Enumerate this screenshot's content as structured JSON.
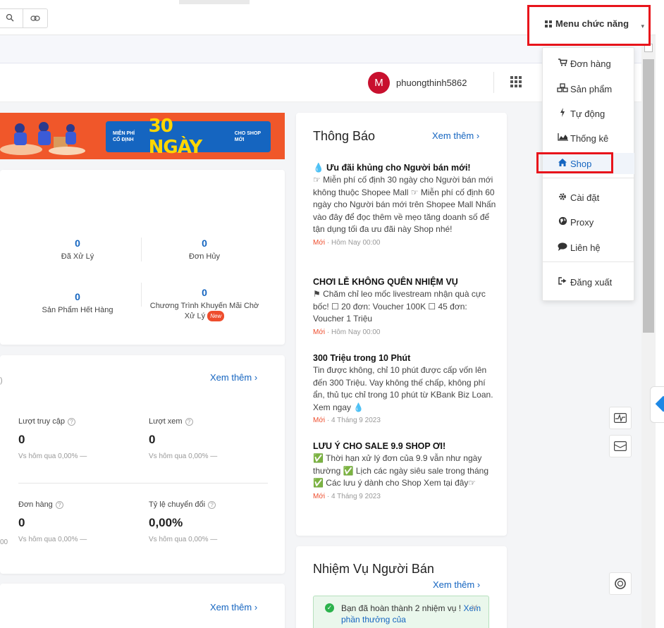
{
  "toolbar": {
    "zoom_icon": "zoom-icon",
    "link_icon": "link-icon"
  },
  "menu": {
    "label": "Menu chức năng",
    "items": [
      {
        "label": "Đơn hàng",
        "icon": "cart-icon"
      },
      {
        "label": "Sản phẩm",
        "icon": "cubes-icon"
      },
      {
        "label": "Tự động",
        "icon": "bolt-icon"
      },
      {
        "label": "Thống kê",
        "icon": "chart-icon"
      },
      {
        "label": "Shop",
        "icon": "home-icon"
      },
      {
        "label": "Cài đặt",
        "icon": "gear-icon"
      },
      {
        "label": "Proxy",
        "icon": "globe-icon"
      },
      {
        "label": "Liên hệ",
        "icon": "chat-icon"
      },
      {
        "label": "Đăng xuất",
        "icon": "logout-icon"
      }
    ]
  },
  "user": {
    "avatar_letter": "M",
    "username": "phuongthinh5862"
  },
  "banner": {
    "small_left": "MIỄN PHÍ CỐ ĐỊNH",
    "big": "30 NGÀY",
    "small_right": "CHO SHOP MỚI"
  },
  "todo": {
    "items": [
      {
        "value": "0",
        "label": "Đã Xử Lý"
      },
      {
        "value": "0",
        "label": "Đơn Hủy"
      },
      {
        "value": "0",
        "label": "Sản Phẩm Hết Hàng"
      },
      {
        "value": "0",
        "label": "Chương Trình Khuyến Mãi Chờ Xử Lý",
        "badge": "New"
      }
    ]
  },
  "analytics": {
    "more_label": "Xem thêm",
    "left_fragment": ")",
    "left_fragment2": "00",
    "metrics": [
      {
        "label": "Lượt truy cập",
        "value": "0",
        "compare": "Vs hôm qua 0,00% —"
      },
      {
        "label": "Lượt xem",
        "value": "0",
        "compare": "Vs hôm qua 0,00% —"
      },
      {
        "label": "Đơn hàng",
        "value": "0",
        "compare": "Vs hôm qua 0,00% —"
      },
      {
        "label": "Tỷ lệ chuyển đổi",
        "value": "0,00%",
        "compare": "Vs hôm qua 0,00% —"
      }
    ]
  },
  "bottom": {
    "more_label": "Xem thêm"
  },
  "notifications": {
    "title": "Thông Báo",
    "more_label": "Xem thêm",
    "items": [
      {
        "title": "💧 Ưu đãi khủng cho Người bán mới!",
        "body": "☞ Miễn phí cố định 30 ngày cho Người bán mới không thuộc Shopee Mall ☞ Miễn phí cố định 60 ngày cho Người bán mới trên Shopee Mall Nhấn vào đây để đọc thêm về mẹo tăng doanh số để tận dụng tối đa ưu đãi này Shop nhé!",
        "tag": "Mới",
        "time": "· Hôm Nay 00:00"
      },
      {
        "title": "CHƠI LỄ KHÔNG QUÊN NHIỆM VỤ",
        "body": "⚑ Chăm chỉ leo mốc livestream nhận quà cực bốc! ☐ 20 đơn: Voucher 100K ☐ 45 đơn: Voucher 1 Triệu",
        "tag": "Mới",
        "time": "· Hôm Nay 00:00"
      },
      {
        "title": "300 Triệu trong 10 Phút",
        "body": "Tin được không, chỉ 10 phút được cấp vốn lên đến 300 Triệu. Vay không thế chấp, không phí ẩn, thủ tục chỉ trong 10 phút từ KBank Biz Loan. Xem ngay 💧",
        "tag": "Mới",
        "time": "· 4 Tháng 9 2023"
      },
      {
        "title": "LƯU Ý CHO SALE 9.9 SHOP ƠI!",
        "body": "✅ Thời hạn xử lý đơn của 9.9 vẫn như ngày thường ✅ Lịch các ngày siêu sale trong tháng ✅ Các lưu ý dành cho Shop Xem tại đây☞",
        "tag": "Mới",
        "time": "· 4 Tháng 9 2023"
      }
    ]
  },
  "tasks": {
    "title": "Nhiệm Vụ Người Bán",
    "more_label": "Xem thêm",
    "alert_text": "Bạn đã hoàn thành 2 nhiệm vụ ! ",
    "alert_link": "Xem phần thưởng của"
  }
}
